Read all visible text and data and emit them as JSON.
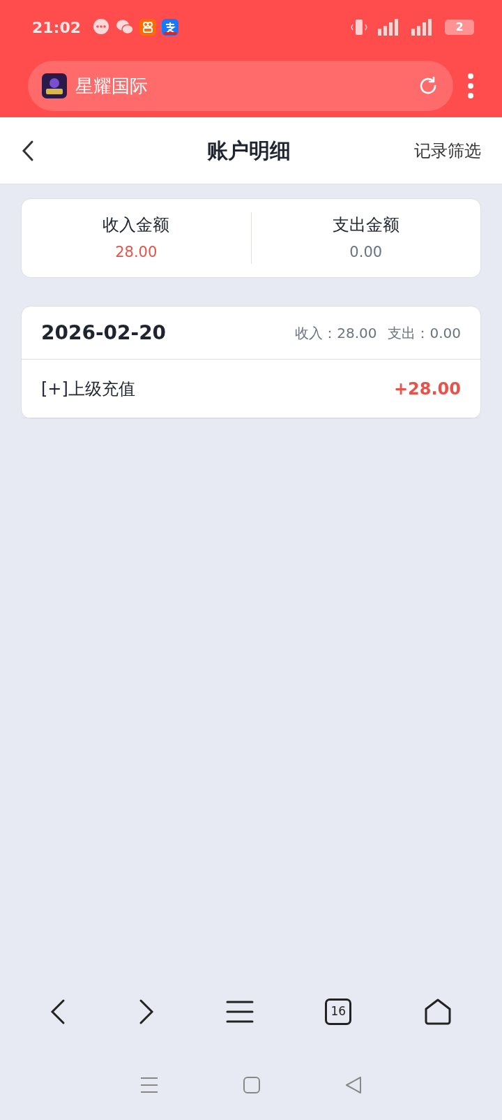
{
  "status_bar": {
    "time": "21:02",
    "battery": "2"
  },
  "browser": {
    "site_title": "星耀国际",
    "tab_count": "16"
  },
  "header": {
    "title": "账户明细",
    "action": "记录筛选"
  },
  "summary": [
    {
      "label": "收入金额",
      "value": "28.00",
      "kind": "income"
    },
    {
      "label": "支出金额",
      "value": "0.00",
      "kind": "expense"
    }
  ],
  "days": [
    {
      "date": "2026-02-20",
      "income": "收入：28.00",
      "expense": "支出：0.00",
      "entries": [
        {
          "label": "[+]上级充值",
          "amount": "+28.00",
          "kind": "income"
        }
      ]
    }
  ]
}
